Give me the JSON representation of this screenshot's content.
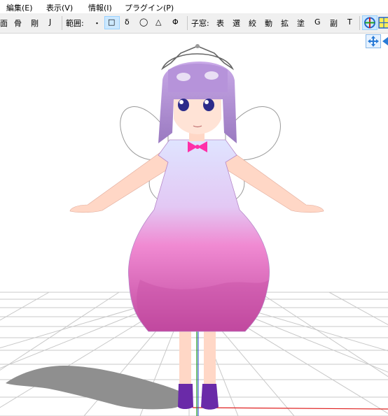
{
  "menu": {
    "edit": "編集(E)",
    "view": "表示(V)",
    "info": "情報(I)",
    "plugin": "プラグイン(P)"
  },
  "toolbar": {
    "face": "面",
    "bone": "骨",
    "rigid": "剛",
    "joint": "J",
    "range_label": "範囲:",
    "range_dot": "・",
    "range_rect": "□",
    "range_delta": "δ",
    "range_circle": "◯",
    "range_triangle": "△",
    "range_phi": "Φ",
    "sub_window_label": "子窓:",
    "table": "表",
    "select": "選",
    "morph": "絞",
    "move": "動",
    "scale": "拡",
    "paint": "塗",
    "g": "G",
    "sub": "副",
    "t": "T"
  },
  "colors": {
    "toolbar_bg": "#f0f0f0",
    "selected_tool": "#cce8ff",
    "grid": "#c8c8c8",
    "axis_x": "#e02020",
    "axis_y": "#1a9a1a",
    "hair": "#a98bcf",
    "dress_top": "#d6dcff",
    "dress_bottom": "#e65fb8",
    "skin": "#ffd7c6",
    "shoes": "#6a2aa8"
  },
  "icons": [
    "viewpoint-rotate-icon",
    "grid-view-icon",
    "move-view-icon"
  ]
}
